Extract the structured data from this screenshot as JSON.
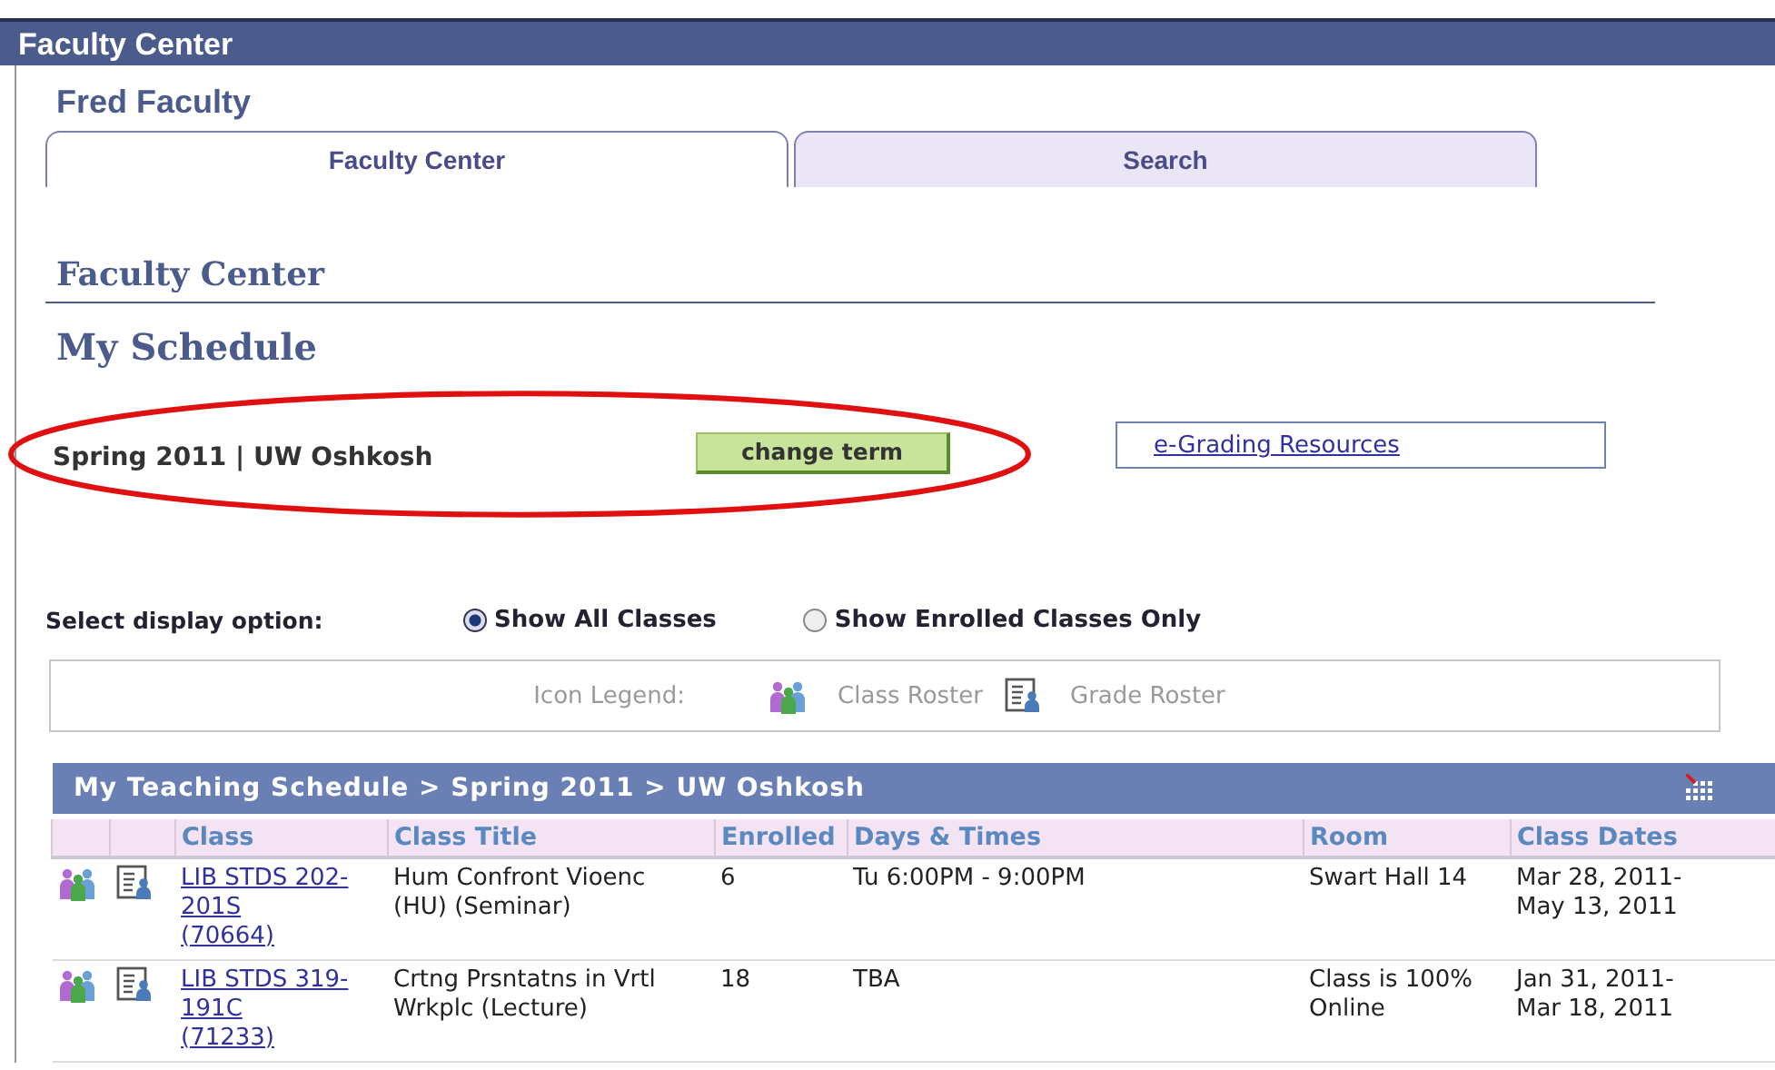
{
  "window": {
    "title": "Faculty Center"
  },
  "user": "Fred Faculty",
  "tabs": [
    {
      "label": "Faculty Center",
      "selected": true
    },
    {
      "label": "Search",
      "selected": false
    }
  ],
  "section_title": "Faculty Center",
  "page_title": "My Schedule",
  "term": {
    "label": "Spring 2011 | UW Oshkosh",
    "button": "change term"
  },
  "resources_link": "e-Grading Resources",
  "display_option": {
    "label": "Select display option:",
    "options": [
      {
        "label": "Show All Classes",
        "selected": true
      },
      {
        "label": "Show Enrolled Classes Only",
        "selected": false
      }
    ]
  },
  "legend": {
    "label": "Icon Legend:",
    "items": [
      {
        "kind": "class-roster",
        "label": "Class Roster"
      },
      {
        "kind": "grade-roster",
        "label": "Grade Roster"
      }
    ]
  },
  "schedule": {
    "title": "My Teaching Schedule > Spring 2011 > UW Oshkosh",
    "columns": [
      "Class",
      "Class Title",
      "Enrolled",
      "Days & Times",
      "Room",
      "Class Dates"
    ],
    "rows": [
      {
        "class": [
          "LIB STDS 202-201S",
          "(70664)"
        ],
        "title": [
          "Hum Confront Vioenc",
          "(HU) (Seminar)"
        ],
        "enrolled": [
          "6"
        ],
        "days_times": [
          "Tu 6:00PM - 9:00PM"
        ],
        "room": [
          "Swart Hall 14"
        ],
        "dates": [
          "Mar 28, 2011-",
          "May 13, 2011"
        ]
      },
      {
        "class": [
          "LIB STDS 319-191C",
          "(71233)"
        ],
        "title": [
          "Crtng Prsntatns in Vrtl",
          "Wrkplc (Lecture)"
        ],
        "enrolled": [
          "18"
        ],
        "days_times": [
          "TBA"
        ],
        "room": [
          "Class is 100%",
          "Online"
        ],
        "dates": [
          "Jan 31, 2011-",
          "Mar 18, 2011"
        ]
      }
    ]
  }
}
